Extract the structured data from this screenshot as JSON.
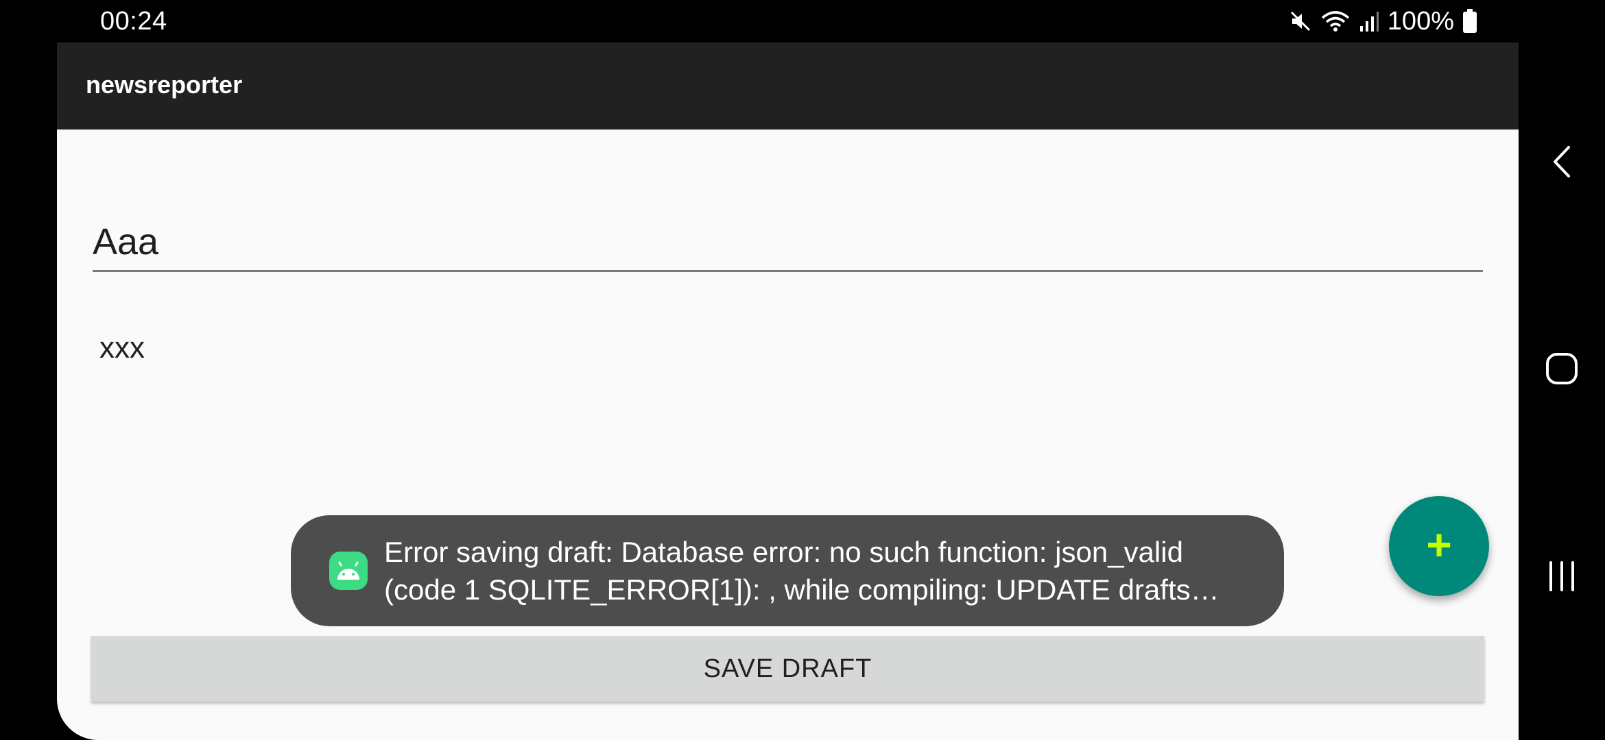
{
  "status_bar": {
    "time": "00:24",
    "battery_percent": "100%",
    "icons": [
      "mute-icon",
      "wifi-icon",
      "signal-icon",
      "battery-icon"
    ]
  },
  "app": {
    "title": "newsreporter",
    "title_field_value": "Aaa",
    "body_field_value": "xxx",
    "save_label": "SAVE DRAFT",
    "fab_icon": "plus-icon",
    "fab_label": "+"
  },
  "toast": {
    "icon": "android-icon",
    "line1": "Error saving draft: Database error: no such function: json_valid",
    "line2": "(code 1 SQLITE_ERROR[1]): , while compiling: UPDATE drafts…"
  },
  "nav_bar": {
    "icons": [
      "back-icon",
      "home-icon",
      "recents-icon"
    ]
  },
  "colors": {
    "app_bar": "#212121",
    "background": "#fafafa",
    "fab": "#00897b",
    "fab_plus": "#c6ff00",
    "toast_bg": "#4d4d4d",
    "button_bg": "#d6d7d7",
    "android_green": "#3ddc84"
  }
}
